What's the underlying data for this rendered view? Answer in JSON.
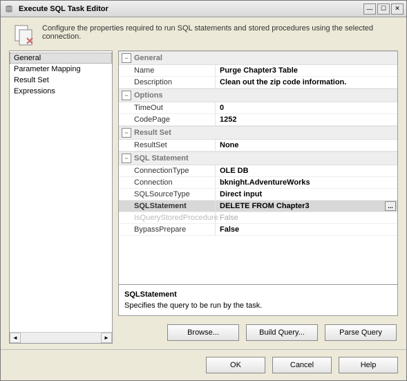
{
  "window": {
    "title": "Execute SQL Task Editor"
  },
  "header": {
    "text": "Configure the properties required to run SQL statements and stored procedures using the selected connection."
  },
  "sidebar": {
    "items": [
      {
        "label": "General",
        "selected": true
      },
      {
        "label": "Parameter Mapping",
        "selected": false
      },
      {
        "label": "Result Set",
        "selected": false
      },
      {
        "label": "Expressions",
        "selected": false
      }
    ]
  },
  "grid": {
    "sections": [
      {
        "title": "General",
        "rows": [
          {
            "label": "Name",
            "value": "Purge Chapter3 Table"
          },
          {
            "label": "Description",
            "value": "Clean out the zip code information."
          }
        ]
      },
      {
        "title": "Options",
        "rows": [
          {
            "label": "TimeOut",
            "value": "0"
          },
          {
            "label": "CodePage",
            "value": "1252"
          }
        ]
      },
      {
        "title": "Result Set",
        "rows": [
          {
            "label": "ResultSet",
            "value": "None"
          }
        ]
      },
      {
        "title": "SQL Statement",
        "rows": [
          {
            "label": "ConnectionType",
            "value": "OLE DB"
          },
          {
            "label": "Connection",
            "value": "bknight.AdventureWorks"
          },
          {
            "label": "SQLSourceType",
            "value": "Direct input"
          },
          {
            "label": "SQLStatement",
            "value": "DELETE FROM Chapter3",
            "selected": true,
            "hasEdit": true
          },
          {
            "label": "IsQueryStoredProcedure",
            "value": "False",
            "disabled": true
          },
          {
            "label": "BypassPrepare",
            "value": "False"
          }
        ]
      }
    ]
  },
  "helpPanel": {
    "title": "SQLStatement",
    "text": "Specifies the query to be run by the task."
  },
  "queryButtons": {
    "browse": "Browse...",
    "build": "Build Query...",
    "parse": "Parse Query"
  },
  "footerButtons": {
    "ok": "OK",
    "cancel": "Cancel",
    "help": "Help"
  },
  "editButton": "..."
}
